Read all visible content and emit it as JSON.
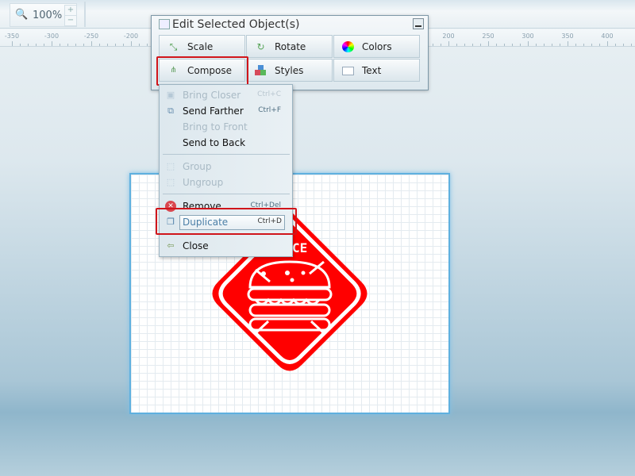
{
  "toolbar": {
    "zoom_value": "100%",
    "zoom_in": "+",
    "zoom_out": "−",
    "search_icon": "magnifier-icon"
  },
  "ruler": {
    "labels": [
      "-350",
      "-300",
      "-250",
      "-200",
      "200",
      "250",
      "300",
      "350",
      "400"
    ]
  },
  "dialog": {
    "title": "Edit Selected Object(s)",
    "buttons": [
      {
        "label": "Scale",
        "icon": "scale-icon"
      },
      {
        "label": "Rotate",
        "icon": "rotate-icon"
      },
      {
        "label": "Colors",
        "icon": "color-wheel-icon"
      },
      {
        "label": "Compose",
        "icon": "hierarchy-icon"
      },
      {
        "label": "Styles",
        "icon": "shapes-icon"
      },
      {
        "label": "Text",
        "icon": "text-box-icon"
      }
    ]
  },
  "menu": {
    "items": [
      {
        "label": "Bring Closer",
        "shortcut": "Ctrl+C",
        "enabled": false
      },
      {
        "label": "Send Farther",
        "shortcut": "Ctrl+F",
        "enabled": true
      },
      {
        "label": "Bring to Front",
        "shortcut": "",
        "enabled": false
      },
      {
        "label": "Send to Back",
        "shortcut": "",
        "enabled": true
      },
      {
        "label": "Group",
        "shortcut": "",
        "enabled": false
      },
      {
        "label": "Ungroup",
        "shortcut": "",
        "enabled": false
      },
      {
        "label": "Remove",
        "shortcut": "Ctrl+Del",
        "enabled": true
      },
      {
        "label": "Duplicate",
        "shortcut": "Ctrl+D",
        "enabled": true,
        "selected": true
      },
      {
        "label": "Close",
        "shortcut": "",
        "enabled": true
      }
    ]
  },
  "canvas": {
    "logo_text": "CE",
    "logo_color": "#ff0000"
  },
  "colors": {
    "highlight": "#d0151b",
    "canvas_border": "#5fb0df"
  }
}
